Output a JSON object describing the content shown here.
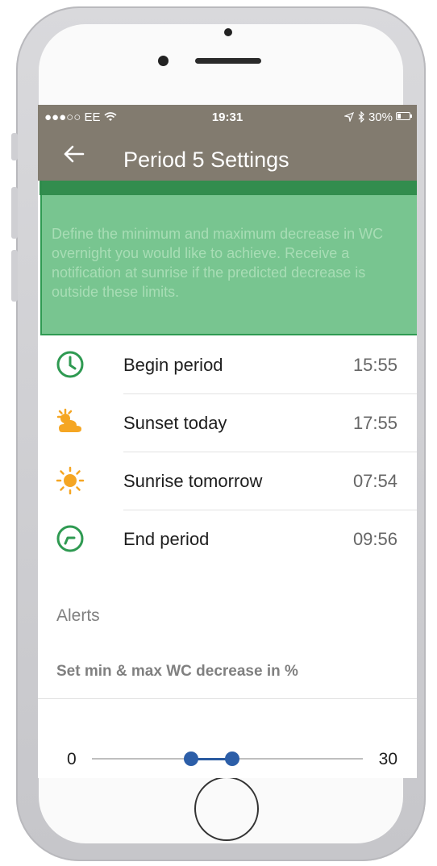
{
  "status_bar": {
    "carrier": "●●●○○ EE",
    "time": "19:31",
    "battery_text": "30%",
    "battery_level": 0.3
  },
  "app_bar": {
    "title": "Period 5 Settings"
  },
  "info_overlay": {
    "text": "Define the minimum and maximum decrease in WC overnight you would like to achieve. Receive a notification at sunrise if the predicted decrease is outside these limits."
  },
  "rows": [
    {
      "label": "Begin period",
      "value": "15:55",
      "icon": "clock-icon"
    },
    {
      "label": "Sunset today",
      "value": "17:55",
      "icon": "sunset-cloud-icon"
    },
    {
      "label": "Sunrise tomorrow",
      "value": "07:54",
      "icon": "sun-icon"
    },
    {
      "label": "End period",
      "value": "09:56",
      "icon": "clock-end-icon"
    }
  ],
  "alerts": {
    "section_title": "Alerts",
    "slider_title": "Set min & max WC decrease in %",
    "slider_min": "0",
    "slider_max": "30",
    "range_min": 0,
    "range_max": 30,
    "selected_low": 11,
    "selected_high": 15.5
  },
  "colors": {
    "header": "#827b6f",
    "accent_green": "#2f9a52",
    "overlay_green": "#78c590",
    "sun_orange": "#f5a623",
    "slider_blue": "#2c5ea8"
  }
}
